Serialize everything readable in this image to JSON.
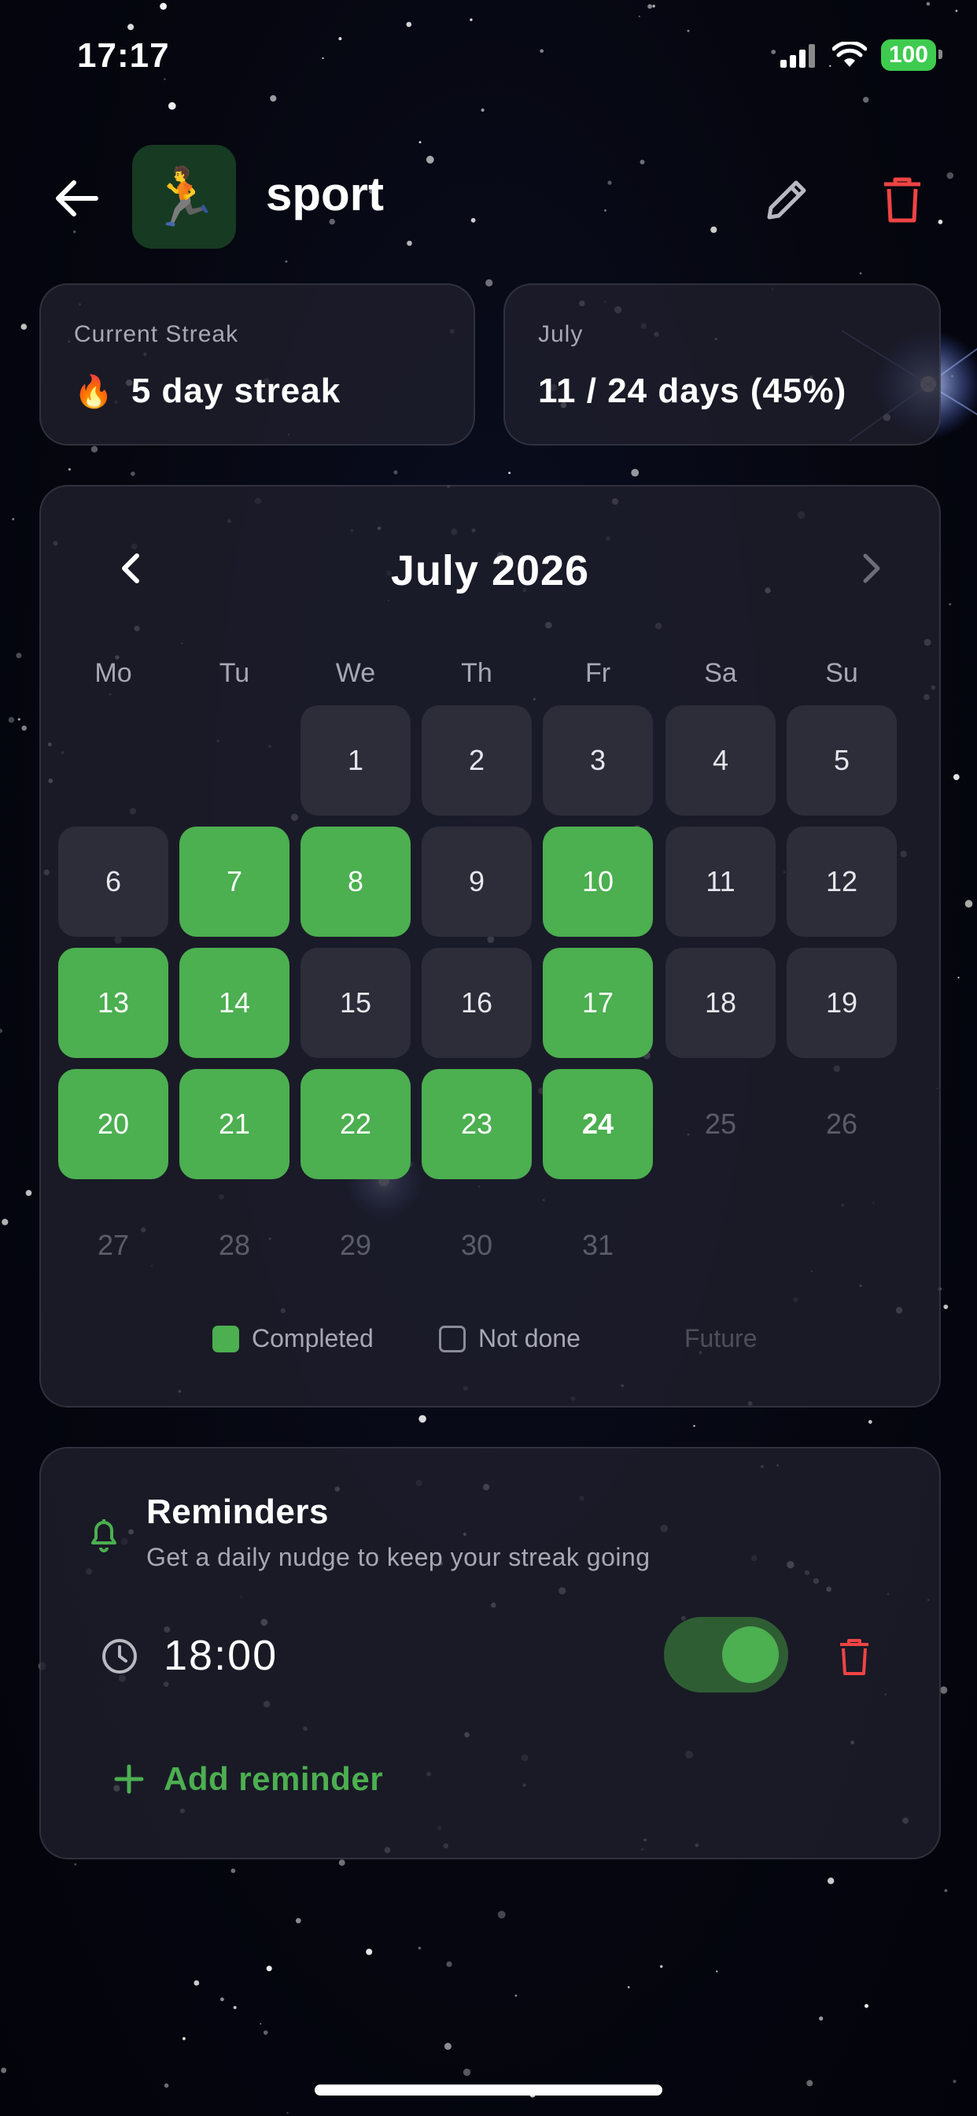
{
  "status_bar": {
    "time": "17:17",
    "battery": "100"
  },
  "header": {
    "title": "sport",
    "habit_emoji": "🏃"
  },
  "stats": {
    "streak": {
      "label": "Current Streak",
      "emoji": "🔥",
      "value": "5 day streak"
    },
    "month": {
      "label": "July",
      "value": "11 / 24 days (45%)"
    }
  },
  "calendar": {
    "title": "July 2026",
    "weekdays": [
      "Mo",
      "Tu",
      "We",
      "Th",
      "Fr",
      "Sa",
      "Su"
    ],
    "days": [
      {
        "label": "1",
        "state": "notdone"
      },
      {
        "label": "2",
        "state": "notdone"
      },
      {
        "label": "3",
        "state": "notdone"
      },
      {
        "label": "4",
        "state": "notdone"
      },
      {
        "label": "5",
        "state": "notdone"
      },
      {
        "label": "6",
        "state": "notdone"
      },
      {
        "label": "7",
        "state": "completed"
      },
      {
        "label": "8",
        "state": "completed"
      },
      {
        "label": "9",
        "state": "notdone"
      },
      {
        "label": "10",
        "state": "completed"
      },
      {
        "label": "11",
        "state": "notdone"
      },
      {
        "label": "12",
        "state": "notdone"
      },
      {
        "label": "13",
        "state": "completed"
      },
      {
        "label": "14",
        "state": "completed"
      },
      {
        "label": "15",
        "state": "notdone"
      },
      {
        "label": "16",
        "state": "notdone"
      },
      {
        "label": "17",
        "state": "completed"
      },
      {
        "label": "18",
        "state": "notdone"
      },
      {
        "label": "19",
        "state": "notdone"
      },
      {
        "label": "20",
        "state": "completed"
      },
      {
        "label": "21",
        "state": "completed"
      },
      {
        "label": "22",
        "state": "completed"
      },
      {
        "label": "23",
        "state": "completed"
      },
      {
        "label": "24",
        "state": "completed",
        "today": true
      },
      {
        "label": "25",
        "state": "future"
      },
      {
        "label": "26",
        "state": "future"
      },
      {
        "label": "27",
        "state": "future"
      },
      {
        "label": "28",
        "state": "future"
      },
      {
        "label": "29",
        "state": "future"
      },
      {
        "label": "30",
        "state": "future"
      },
      {
        "label": "31",
        "state": "future"
      }
    ],
    "first_weekday_index": 2,
    "legend": {
      "completed": "Completed",
      "not_done": "Not done",
      "future": "Future"
    }
  },
  "reminders": {
    "title": "Reminders",
    "subtitle": "Get a daily nudge to keep your streak going",
    "items": [
      {
        "time": "18:00",
        "enabled": true
      }
    ],
    "add_label": "Add reminder"
  },
  "colors": {
    "accent": "#4caf50",
    "danger": "#ef4444",
    "card_bg": "#1e1f2c",
    "not_done_cell": "#2c2d39"
  }
}
